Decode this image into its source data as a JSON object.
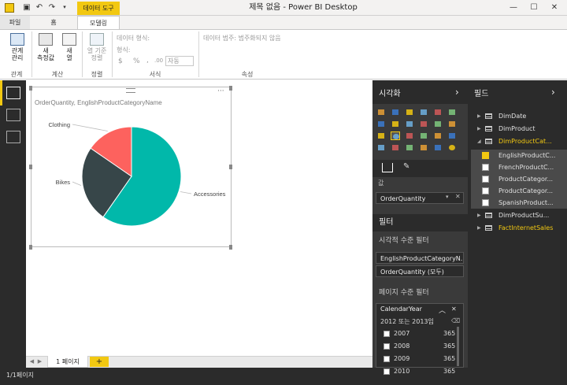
{
  "window": {
    "title": "제목 없음 - Power BI Desktop",
    "minimize": "—",
    "maximize": "☐",
    "close": "✕"
  },
  "quick_access": {
    "save_icon": "save-icon",
    "undo_icon": "undo-icon",
    "redo_icon": "redo-icon"
  },
  "tabs": {
    "context_label": "데이터 도구",
    "file": "파일",
    "home": "홈",
    "modeling": "모델링"
  },
  "ribbon": {
    "relationships": {
      "line1": "관계",
      "line2": "관리"
    },
    "new_measure": {
      "line1": "새",
      "line2": "측정값"
    },
    "new_column": {
      "line1": "새",
      "line2": "열"
    },
    "sort_by_column": {
      "line1": "열 기준",
      "line2": "정렬"
    },
    "data_type": "데이터 형식:",
    "format": "형식:",
    "currency": "$",
    "percent": "%",
    "comma": ",",
    "decimals": ".00",
    "auto": "자동",
    "data_category": "데이터 범주: 범주화되지 않음",
    "groups": {
      "relationships": "관계",
      "calculations": "계산",
      "sort": "정렬",
      "formatting": "서식",
      "properties": "속성"
    }
  },
  "visual": {
    "title": "OrderQuantity, EnglishProductCategoryName",
    "more": "···"
  },
  "chart_data": {
    "type": "pie",
    "title": "OrderQuantity, EnglishProductCategoryName",
    "categories": [
      "Accessories",
      "Bikes",
      "Clothing"
    ],
    "values": [
      59.7,
      24.9,
      15.4
    ],
    "colors": [
      "#01b8aa",
      "#374649",
      "#fd625e"
    ],
    "legend": "none",
    "labels": "outside"
  },
  "pages": {
    "tab1": "1 페이지",
    "add": "+",
    "prev": "◀",
    "next": "▶"
  },
  "status": "1/1페이지",
  "viz_pane": {
    "title": "시각화",
    "collapse": "›",
    "values_label": "값",
    "value_field": "OrderQuantity",
    "filters_title": "필터",
    "visual_filters": "시각적 수준 필터",
    "filter1": "EnglishProductCategoryN...",
    "filter2": "OrderQuantity (모두)",
    "page_filters": "페이지 수준 필터",
    "card": {
      "field": "CalendarYear",
      "desc": "2012 또는 2013임",
      "rows": [
        {
          "year": "2007",
          "count": "365"
        },
        {
          "year": "2008",
          "count": "365"
        },
        {
          "year": "2009",
          "count": "365"
        },
        {
          "year": "2010",
          "count": "365"
        }
      ]
    }
  },
  "fields_pane": {
    "title": "필드",
    "collapse": "›",
    "items": [
      {
        "label": "DimDate"
      },
      {
        "label": "DimProduct"
      },
      {
        "label": "DimProductCat..."
      },
      {
        "label": "EnglishProductC..."
      },
      {
        "label": "FrenchProductC..."
      },
      {
        "label": "ProductCategor..."
      },
      {
        "label": "ProductCategor..."
      },
      {
        "label": "SpanishProduct..."
      },
      {
        "label": "DimProductSu..."
      },
      {
        "label": "FactInternetSales"
      }
    ]
  }
}
